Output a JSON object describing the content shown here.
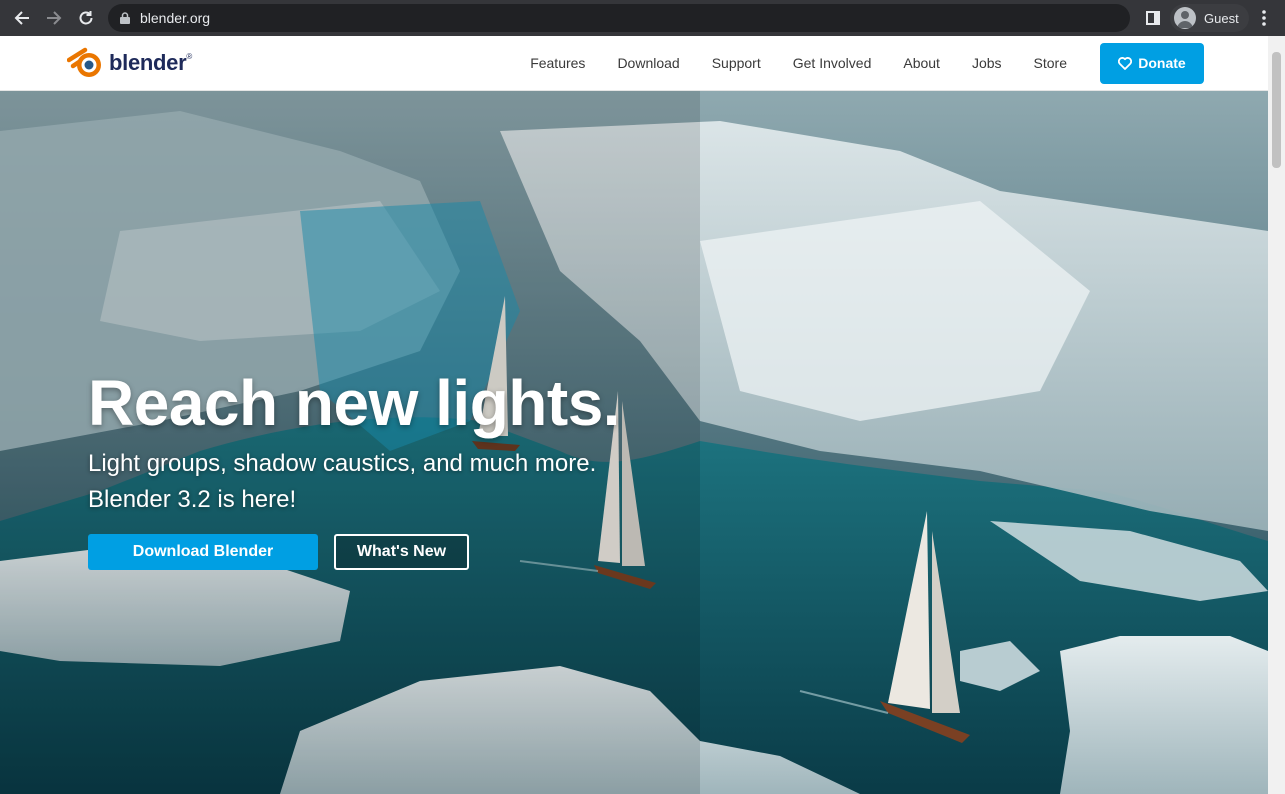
{
  "browser": {
    "url": "blender.org",
    "profile_label": "Guest"
  },
  "site": {
    "logo_text": "blender",
    "logo_tm": "®",
    "nav": [
      "Features",
      "Download",
      "Support",
      "Get Involved",
      "About",
      "Jobs",
      "Store"
    ],
    "donate_label": "Donate"
  },
  "hero": {
    "headline": "Reach new lights.",
    "subline_1": "Light groups, shadow caustics, and much more.",
    "subline_2": "Blender 3.2 is here!",
    "primary_button": "Download Blender",
    "secondary_button": "What's New"
  },
  "colors": {
    "accent": "#009fe3",
    "logo_orange": "#ea7600",
    "logo_blue": "#265787"
  }
}
